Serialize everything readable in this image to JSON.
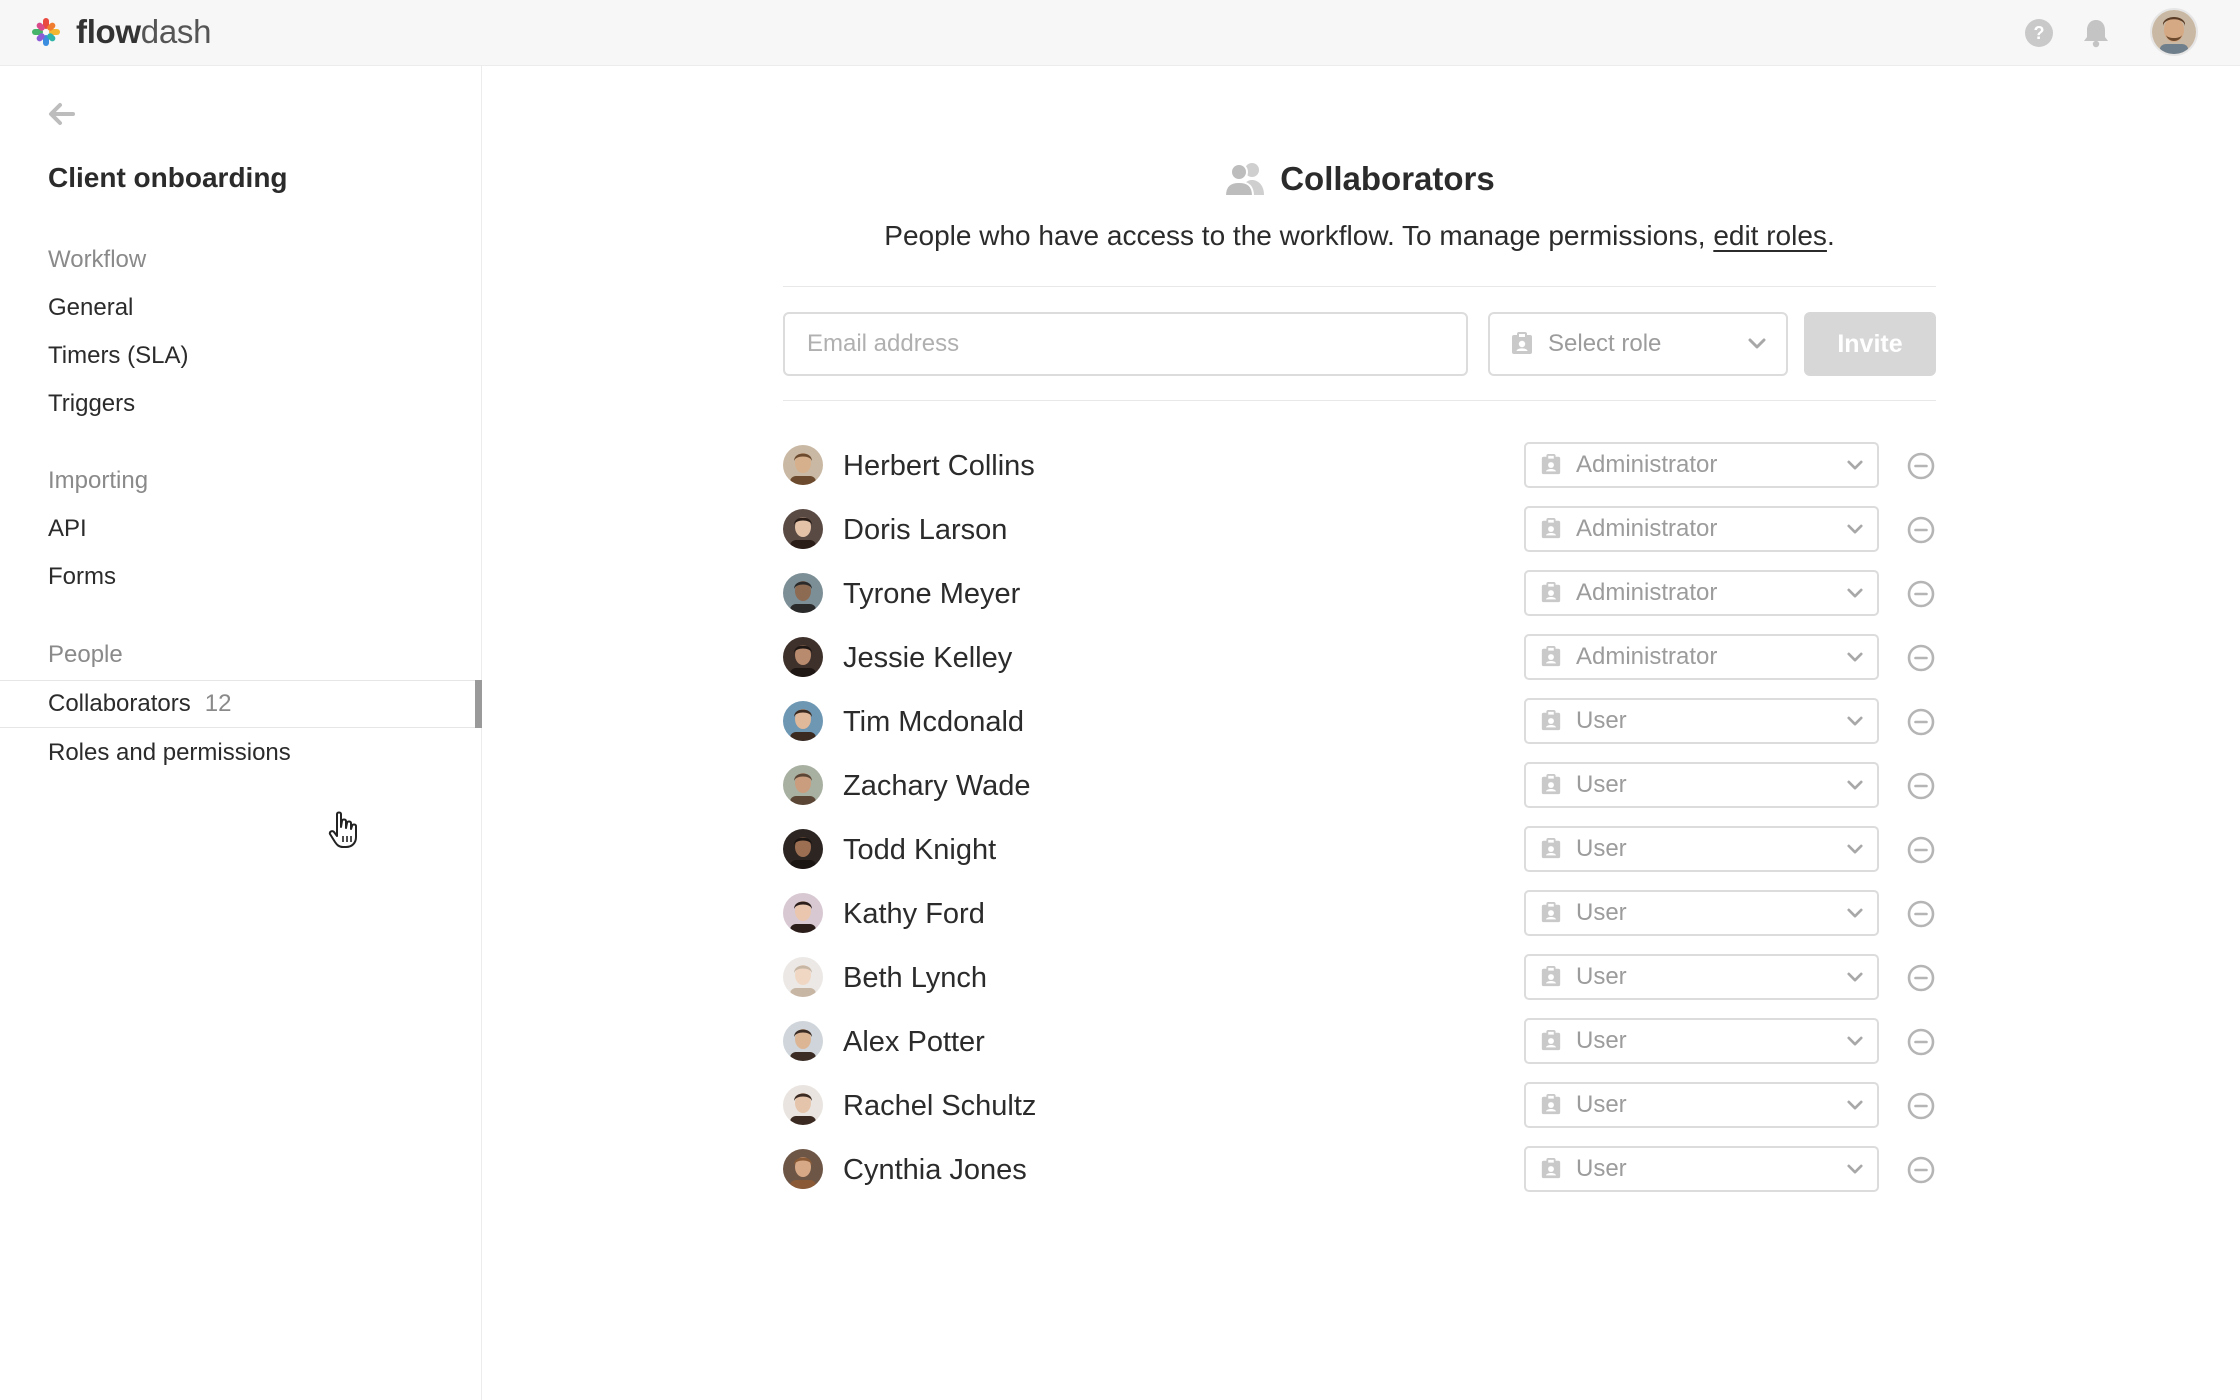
{
  "app": {
    "logo_bold": "flow",
    "logo_light": "dash"
  },
  "sidebar": {
    "title": "Client onboarding",
    "sections": [
      {
        "label": "Workflow",
        "items": [
          "General",
          "Timers (SLA)",
          "Triggers"
        ]
      },
      {
        "label": "Importing",
        "items": [
          "API",
          "Forms"
        ]
      },
      {
        "label": "People",
        "items": [
          "Collaborators",
          "Roles and permissions"
        ]
      }
    ],
    "active_item": {
      "label": "Collaborators",
      "count": "12"
    },
    "last_item": "Roles and permissions"
  },
  "main": {
    "title": "Collaborators",
    "description": "People who have access to the workflow. To manage permissions, ",
    "description_link": "edit roles",
    "description_end": ".",
    "email_placeholder": "Email address",
    "role_placeholder": "Select role",
    "invite_label": "Invite"
  },
  "collaborators": [
    {
      "name": "Herbert Collins",
      "role": "Administrator",
      "skin": "#d6b08c",
      "hair": "#6b4a2e",
      "bg": "#c9b8a3"
    },
    {
      "name": "Doris Larson",
      "role": "Administrator",
      "skin": "#e3c2a8",
      "hair": "#2a1d18",
      "bg": "#5a4a44"
    },
    {
      "name": "Tyrone Meyer",
      "role": "Administrator",
      "skin": "#8d6a52",
      "hair": "#2a2a2a",
      "bg": "#7d8f96"
    },
    {
      "name": "Jessie Kelley",
      "role": "Administrator",
      "skin": "#b88a6e",
      "hair": "#1f1714",
      "bg": "#3e302a"
    },
    {
      "name": "Tim Mcdonald",
      "role": "User",
      "skin": "#e0b89a",
      "hair": "#3b2a20",
      "bg": "#6d97b3"
    },
    {
      "name": "Zachary Wade",
      "role": "User",
      "skin": "#c99d7e",
      "hair": "#5b4636",
      "bg": "#a8b0a2"
    },
    {
      "name": "Todd Knight",
      "role": "User",
      "skin": "#9c6e52",
      "hair": "#1a1412",
      "bg": "#2c2522"
    },
    {
      "name": "Kathy Ford",
      "role": "User",
      "skin": "#e9c6ad",
      "hair": "#2b1e1a",
      "bg": "#d8c8d2"
    },
    {
      "name": "Beth Lynch",
      "role": "User",
      "skin": "#efd7c4",
      "hair": "#c8b6a4",
      "bg": "#ebe8e5"
    },
    {
      "name": "Alex Potter",
      "role": "User",
      "skin": "#dcb594",
      "hair": "#3a2c24",
      "bg": "#cfd5da"
    },
    {
      "name": "Rachel Schultz",
      "role": "User",
      "skin": "#e4c4ab",
      "hair": "#3a2a22",
      "bg": "#e9e4df"
    },
    {
      "name": "Cynthia Jones",
      "role": "User",
      "skin": "#d8a987",
      "hair": "#8a5a36",
      "bg": "#6e5646"
    }
  ],
  "colors": {
    "accent_gray": "#9a9a9a",
    "logo_red": "#e9493f",
    "logo_blue": "#3b8de0",
    "logo_green": "#46b46a",
    "logo_yellow": "#f2b631"
  }
}
